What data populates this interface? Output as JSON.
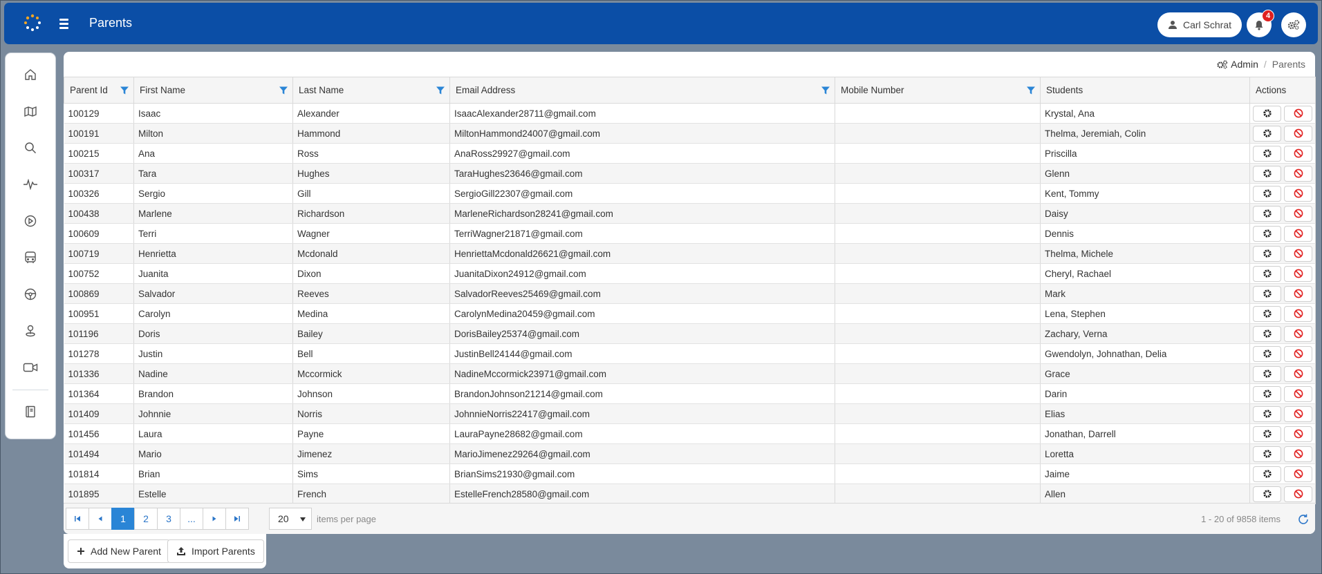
{
  "header": {
    "title": "Parents",
    "user_name": "Carl Schrat",
    "notification_count": "4"
  },
  "breadcrumb": {
    "admin_label": "Admin",
    "current": "Parents"
  },
  "nav": {
    "icons": [
      "home-icon",
      "map-icon",
      "search-icon",
      "activity-icon",
      "play-icon",
      "bus-icon",
      "steering-wheel-icon",
      "location-icon",
      "video-icon",
      "book-icon"
    ]
  },
  "table": {
    "columns": [
      "Parent Id",
      "First Name",
      "Last Name",
      "Email Address",
      "Mobile Number",
      "Students",
      "Actions"
    ],
    "rows": [
      {
        "id": "100129",
        "first": "Isaac",
        "last": "Alexander",
        "email": "IsaacAlexander28711@gmail.com",
        "mobile": "",
        "students": "Krystal, Ana"
      },
      {
        "id": "100191",
        "first": "Milton",
        "last": "Hammond",
        "email": "MiltonHammond24007@gmail.com",
        "mobile": "",
        "students": "Thelma, Jeremiah, Colin"
      },
      {
        "id": "100215",
        "first": "Ana",
        "last": "Ross",
        "email": "AnaRoss29927@gmail.com",
        "mobile": "",
        "students": "Priscilla"
      },
      {
        "id": "100317",
        "first": "Tara",
        "last": "Hughes",
        "email": "TaraHughes23646@gmail.com",
        "mobile": "",
        "students": "Glenn"
      },
      {
        "id": "100326",
        "first": "Sergio",
        "last": "Gill",
        "email": "SergioGill22307@gmail.com",
        "mobile": "",
        "students": "Kent, Tommy"
      },
      {
        "id": "100438",
        "first": "Marlene",
        "last": "Richardson",
        "email": "MarleneRichardson28241@gmail.com",
        "mobile": "",
        "students": "Daisy"
      },
      {
        "id": "100609",
        "first": "Terri",
        "last": "Wagner",
        "email": "TerriWagner21871@gmail.com",
        "mobile": "",
        "students": "Dennis"
      },
      {
        "id": "100719",
        "first": "Henrietta",
        "last": "Mcdonald",
        "email": "HenriettaMcdonald26621@gmail.com",
        "mobile": "",
        "students": "Thelma, Michele"
      },
      {
        "id": "100752",
        "first": "Juanita",
        "last": "Dixon",
        "email": "JuanitaDixon24912@gmail.com",
        "mobile": "",
        "students": "Cheryl, Rachael"
      },
      {
        "id": "100869",
        "first": "Salvador",
        "last": "Reeves",
        "email": "SalvadorReeves25469@gmail.com",
        "mobile": "",
        "students": "Mark"
      },
      {
        "id": "100951",
        "first": "Carolyn",
        "last": "Medina",
        "email": "CarolynMedina20459@gmail.com",
        "mobile": "",
        "students": "Lena, Stephen"
      },
      {
        "id": "101196",
        "first": "Doris",
        "last": "Bailey",
        "email": "DorisBailey25374@gmail.com",
        "mobile": "",
        "students": "Zachary, Verna"
      },
      {
        "id": "101278",
        "first": "Justin",
        "last": "Bell",
        "email": "JustinBell24144@gmail.com",
        "mobile": "",
        "students": "Gwendolyn, Johnathan, Delia"
      },
      {
        "id": "101336",
        "first": "Nadine",
        "last": "Mccormick",
        "email": "NadineMccormick23971@gmail.com",
        "mobile": "",
        "students": "Grace"
      },
      {
        "id": "101364",
        "first": "Brandon",
        "last": "Johnson",
        "email": "BrandonJohnson21214@gmail.com",
        "mobile": "",
        "students": "Darin"
      },
      {
        "id": "101409",
        "first": "Johnnie",
        "last": "Norris",
        "email": "JohnnieNorris22417@gmail.com",
        "mobile": "",
        "students": "Elias"
      },
      {
        "id": "101456",
        "first": "Laura",
        "last": "Payne",
        "email": "LauraPayne28682@gmail.com",
        "mobile": "",
        "students": "Jonathan, Darrell"
      },
      {
        "id": "101494",
        "first": "Mario",
        "last": "Jimenez",
        "email": "MarioJimenez29264@gmail.com",
        "mobile": "",
        "students": "Loretta"
      },
      {
        "id": "101814",
        "first": "Brian",
        "last": "Sims",
        "email": "BrianSims21930@gmail.com",
        "mobile": "",
        "students": "Jaime"
      },
      {
        "id": "101895",
        "first": "Estelle",
        "last": "French",
        "email": "EstelleFrench28580@gmail.com",
        "mobile": "",
        "students": "Allen"
      }
    ]
  },
  "pager": {
    "pages": [
      "1",
      "2",
      "3",
      "..."
    ],
    "current_page": "1",
    "per_page": "20",
    "per_page_label": "items per page",
    "range": "1 - 20 of 9858 items"
  },
  "actions": {
    "add_label": "Add New Parent",
    "import_label": "Import Parents"
  },
  "colors": {
    "header_bg": "#0b4ea6",
    "active_page": "#2a85d6",
    "filter_icon": "#2a85d6",
    "delete_icon": "#e02020"
  }
}
